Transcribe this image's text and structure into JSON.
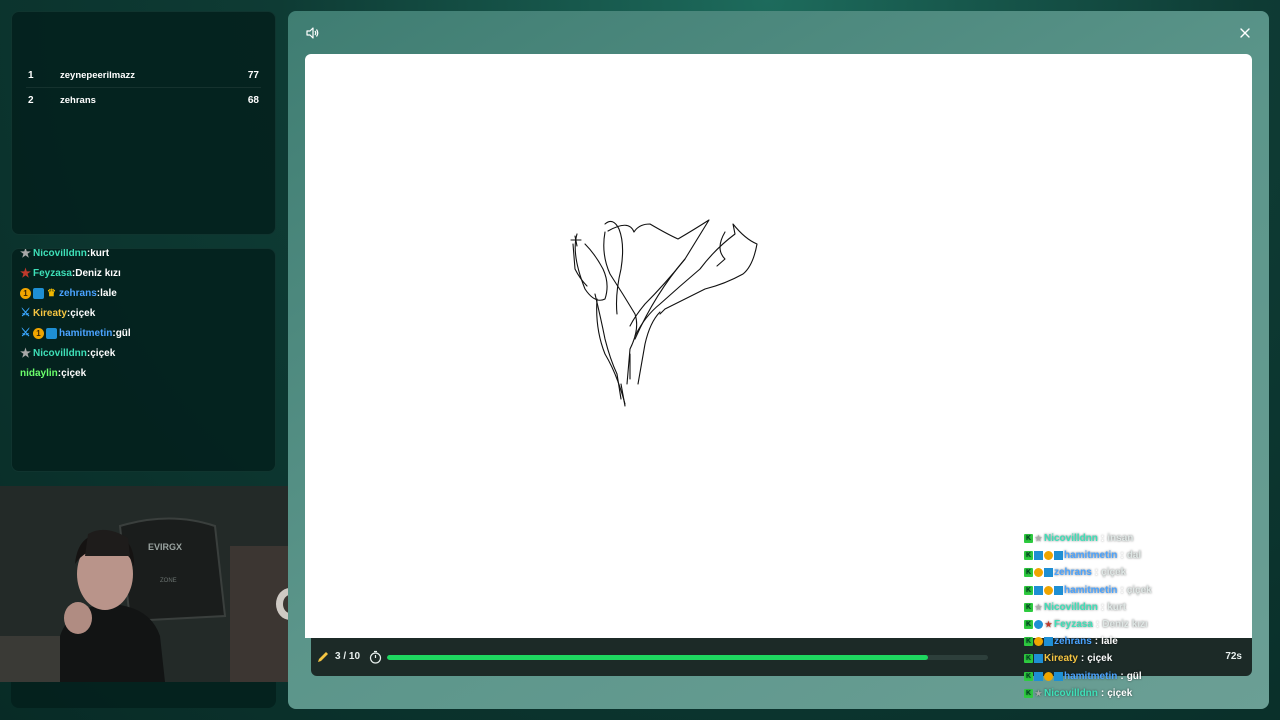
{
  "leaderboard": {
    "rows": [
      {
        "rank": "1",
        "name": "zeynepeerilmazz",
        "score": "77"
      },
      {
        "rank": "2",
        "name": "zehrans",
        "score": "68"
      }
    ]
  },
  "chat": {
    "messages": [
      {
        "user": "Nicovilldnn",
        "text": "kurt"
      },
      {
        "user": "Feyzasa",
        "text": "Deniz kızı"
      },
      {
        "user": "zehrans",
        "text": "lale"
      },
      {
        "user": "Kireaty",
        "text": "çiçek"
      },
      {
        "user": "hamitmetin",
        "text": "gül"
      },
      {
        "user": "Nicovilldnn",
        "text": "çiçek"
      },
      {
        "user": "nidaylin",
        "text": "çiçek"
      }
    ]
  },
  "game": {
    "round": "3 / 10",
    "time_left": "72s",
    "progress": 0.9,
    "canvas_color": "#ffffff",
    "progress_color": "#1ed760"
  },
  "webcam": {
    "chair_brand": "EVIRGX",
    "chair_brand_sub": "ZONE"
  },
  "overlay_chat": {
    "messages": [
      {
        "user": "Nicovilldnn",
        "text": "insan"
      },
      {
        "user": "hamitmetin",
        "text": "dal"
      },
      {
        "user": "zehrans",
        "text": "çiçek"
      },
      {
        "user": "hamitmetin",
        "text": "çiçek"
      },
      {
        "user": "Nicovilldnn",
        "text": "kurt"
      },
      {
        "user": "Feyzasa",
        "text": "Deniz kızı"
      },
      {
        "user": "zehrans",
        "text": "lale"
      },
      {
        "user": "Kireaty",
        "text": "çiçek"
      },
      {
        "user": "hamitmetin",
        "text": "gül"
      },
      {
        "user": "Nicovilldnn",
        "text": "çiçek"
      }
    ]
  },
  "icons": {
    "sound": "speaker-icon",
    "close": "close-icon",
    "pencil": "pencil-icon",
    "timer": "stopwatch-icon"
  }
}
